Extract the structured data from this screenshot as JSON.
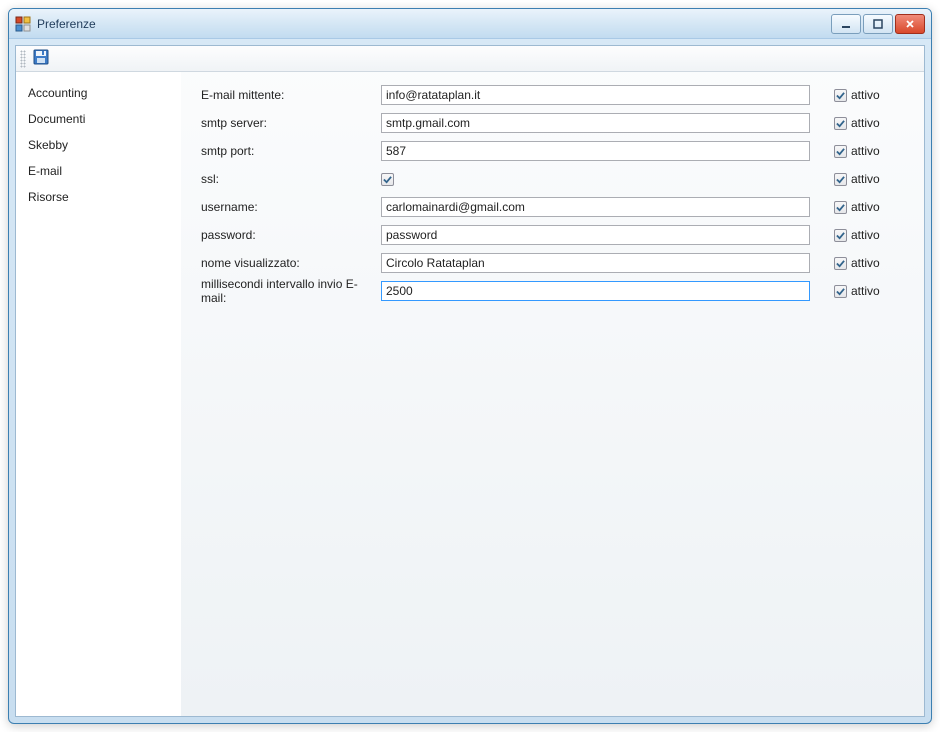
{
  "window": {
    "title": "Preferenze"
  },
  "toolbar": {
    "save_tooltip": "Salva"
  },
  "sidebar": {
    "items": [
      {
        "label": "Accounting"
      },
      {
        "label": "Documenti"
      },
      {
        "label": "Skebby"
      },
      {
        "label": "E-mail"
      },
      {
        "label": "Risorse"
      }
    ]
  },
  "form": {
    "active_label": "attivo",
    "rows": [
      {
        "label": "E-mail mittente:",
        "type": "text",
        "value": "info@ratataplan.it",
        "active": true
      },
      {
        "label": "smtp server:",
        "type": "text",
        "value": "smtp.gmail.com",
        "active": true
      },
      {
        "label": "smtp port:",
        "type": "text",
        "value": "587",
        "active": true
      },
      {
        "label": "ssl:",
        "type": "checkbox",
        "value": true,
        "active": true
      },
      {
        "label": "username:",
        "type": "text",
        "value": "carlomainardi@gmail.com",
        "active": true
      },
      {
        "label": "password:",
        "type": "text",
        "value": "password",
        "active": true
      },
      {
        "label": "nome visualizzato:",
        "type": "text",
        "value": "Circolo Ratataplan",
        "active": true
      },
      {
        "label": "millisecondi intervallo invio E-mail:",
        "type": "text",
        "value": "2500",
        "active": true,
        "highlight": true
      }
    ]
  }
}
